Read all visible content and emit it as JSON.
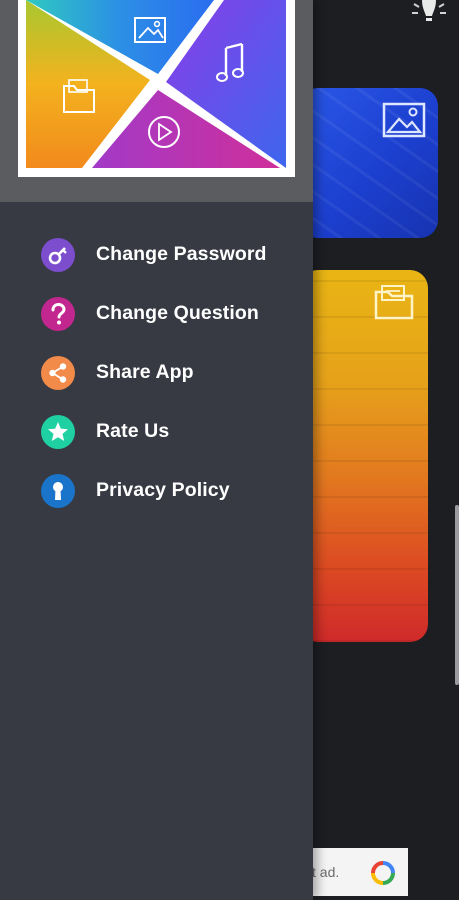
{
  "background": {
    "lightbulb_icon": "lightbulb-icon",
    "images_card_icon": "image-icon",
    "files_card_icon": "folder-icon",
    "ad": {
      "text": "t ad.",
      "icon": "adchoices-icon"
    }
  },
  "drawer": {
    "header": {
      "icons": [
        "image-icon",
        "music-note-icon",
        "folder-icon",
        "play-icon"
      ]
    },
    "menu": [
      {
        "label": "Change Password",
        "icon": "key-icon",
        "color": "#7c4dcc"
      },
      {
        "label": "Change Question",
        "icon": "question-icon",
        "color": "#c2278f"
      },
      {
        "label": "Share App",
        "icon": "share-icon",
        "color": "#f28a4a"
      },
      {
        "label": "Rate Us",
        "icon": "star-icon",
        "color": "#1fd0a2"
      },
      {
        "label": "Privacy Policy",
        "icon": "keyhole-icon",
        "color": "#1a74c9"
      }
    ]
  }
}
